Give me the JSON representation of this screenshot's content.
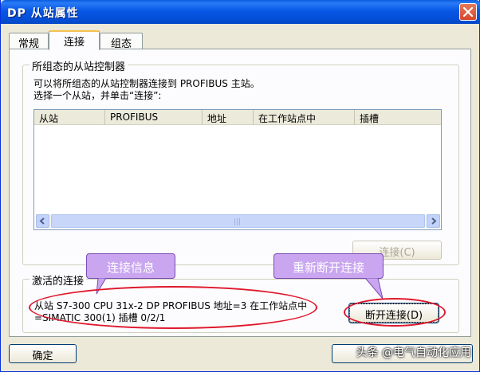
{
  "window": {
    "title": "DP 从站属性",
    "close_label": "×"
  },
  "tabs": [
    {
      "label": "常规"
    },
    {
      "label": "连接"
    },
    {
      "label": "组态"
    }
  ],
  "configured_group": {
    "legend": "所组态的从站控制器",
    "desc_line1": "可以将所组态的从站控制器连接到 PROFIBUS 主站。",
    "desc_line2": "选择一个从站，并单击“连接”:",
    "columns": [
      "从站",
      "PROFIBUS",
      "地址",
      "在工作站点中",
      "插槽"
    ],
    "connect_button": "连接(C)"
  },
  "active_group": {
    "legend": "激活的连接",
    "status_line1": "从站 S7-300 CPU 31x-2 DP PROFIBUS 地址=3 在工作站点中",
    "status_line2": "=SIMATIC 300(1) 插槽 0/2/1",
    "disconnect_button": "断开连接(D)"
  },
  "annotations": {
    "connection_info": "连接信息",
    "reconnect_disconnect": "重新断开连接"
  },
  "footer": {
    "ok_button": "确定",
    "watermark": "头条 @电气自动化应用"
  },
  "colors": {
    "titlebar": "#0858e6",
    "annotation_fill": "#c9a6ef",
    "highlight_ring": "#e0182c"
  }
}
